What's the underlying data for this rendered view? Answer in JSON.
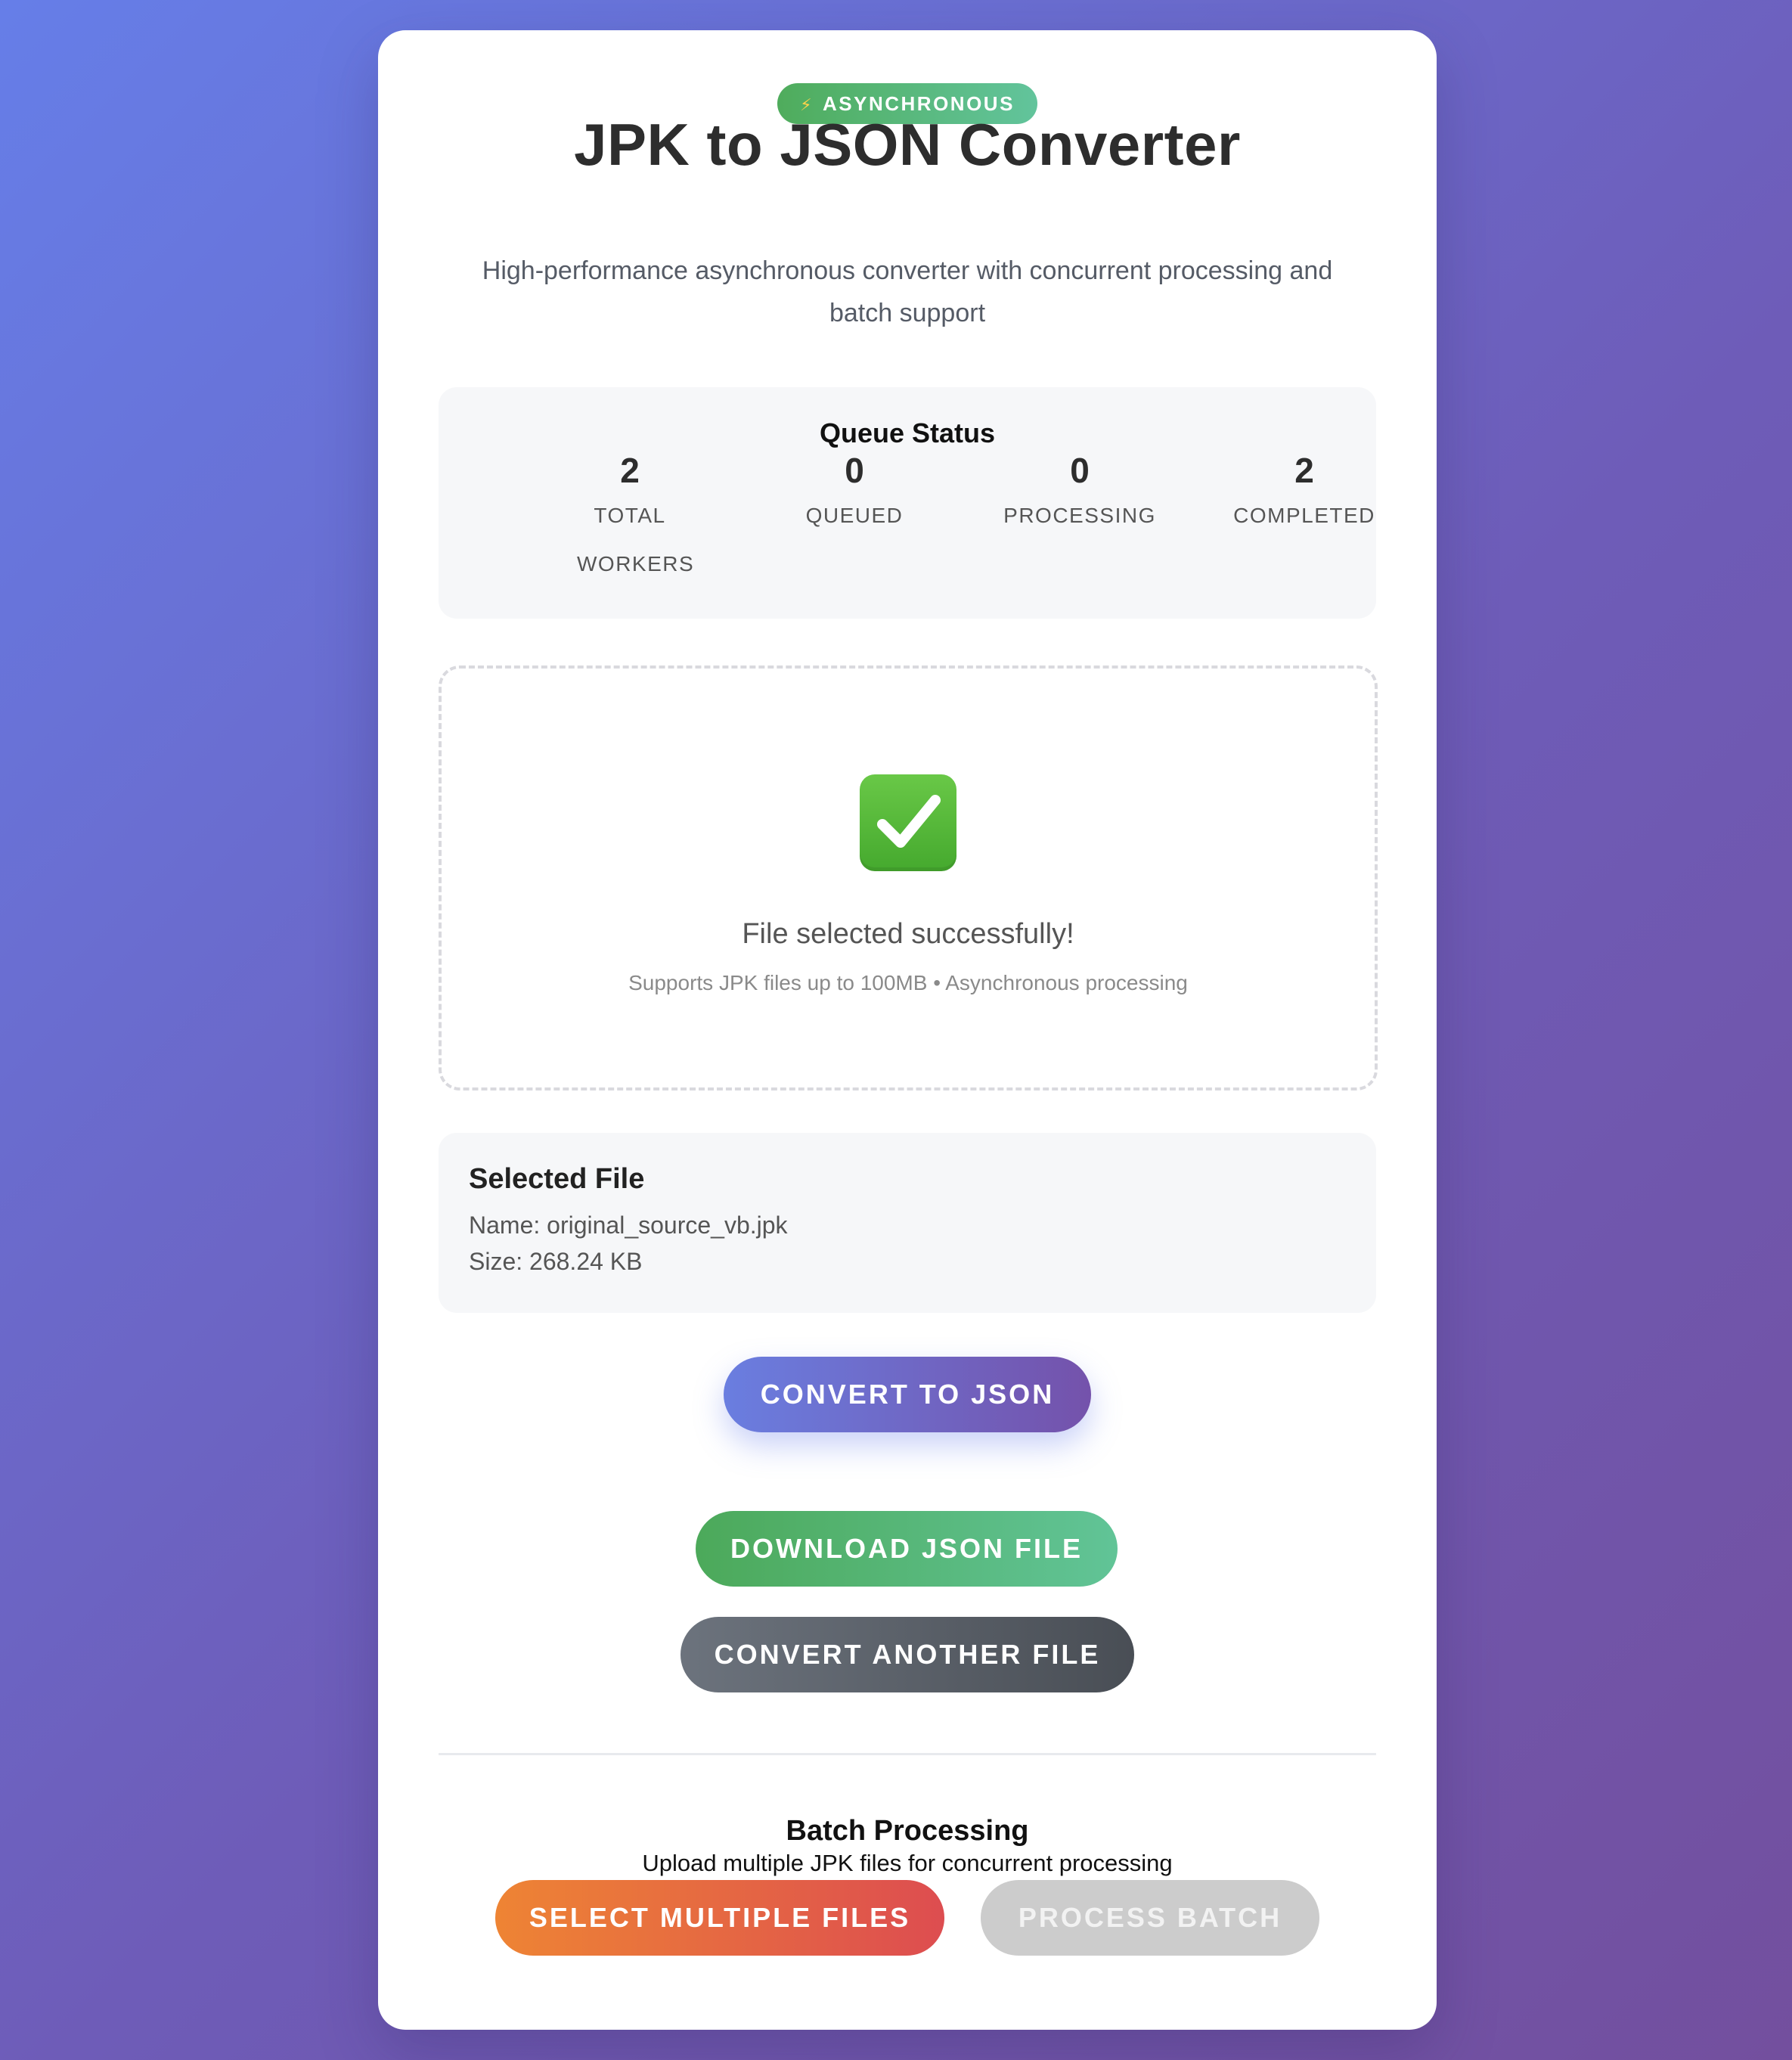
{
  "header": {
    "badge_icon": "⚡",
    "badge_label": "ASYNCHRONOUS",
    "title": "JPK to JSON Converter",
    "subtitle": "High-performance asynchronous converter with concurrent processing and batch support"
  },
  "queue": {
    "title": "Queue Status",
    "stats": [
      {
        "value": "2",
        "label": "TOTAL WORKERS"
      },
      {
        "value": "0",
        "label": "QUEUED"
      },
      {
        "value": "0",
        "label": "PROCESSING"
      },
      {
        "value": "2",
        "label": "COMPLETED"
      }
    ]
  },
  "dropzone": {
    "icon": "check-mark-button-icon",
    "message": "File selected successfully!",
    "hint": "Supports JPK files up to 100MB • Asynchronous processing"
  },
  "selected_file": {
    "title": "Selected File",
    "name_line": "Name: original_source_vb.jpk",
    "size_line": "Size: 268.24 KB"
  },
  "actions": {
    "convert_label": "CONVERT TO JSON",
    "download_label": "DOWNLOAD JSON FILE",
    "another_label": "CONVERT ANOTHER FILE"
  },
  "batch": {
    "title": "Batch Processing",
    "subtitle": "Upload multiple JPK files for concurrent processing",
    "select_label": "SELECT MULTIPLE FILES",
    "process_label": "PROCESS BATCH",
    "process_enabled": false
  },
  "colors": {
    "background_start": "#667ee8",
    "background_end": "#734f9e",
    "badge": "#4fac5c",
    "convert": "#6a7ee0",
    "download": "#4ca95a",
    "another": "#6c737d",
    "select_multiple": "#ee8434",
    "process_disabled": "#cccccc"
  }
}
